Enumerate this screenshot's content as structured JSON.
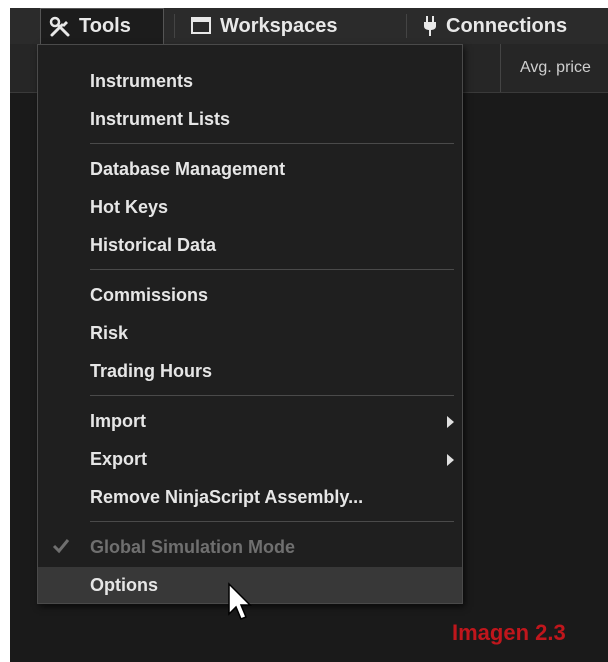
{
  "menubar": {
    "tools": "Tools",
    "workspaces": "Workspaces",
    "connections": "Connections"
  },
  "grid": {
    "avg_price_header": "Avg. price"
  },
  "dropdown": {
    "instruments": "Instruments",
    "instrument_lists": "Instrument Lists",
    "database_management": "Database Management",
    "hot_keys": "Hot Keys",
    "historical_data": "Historical Data",
    "commissions": "Commissions",
    "risk": "Risk",
    "trading_hours": "Trading Hours",
    "import": "Import",
    "export": "Export",
    "remove_ninjascript": "Remove NinjaScript Assembly...",
    "global_simulation_mode": "Global Simulation Mode",
    "options": "Options"
  },
  "watermark": "Imagen 2.3",
  "icons": {
    "tools": "wrench-screwdriver-icon",
    "workspaces": "window-icon",
    "connections": "plug-icon",
    "check": "check-icon",
    "submenu": "chevron-right-icon",
    "cursor": "mouse-pointer-icon"
  },
  "colors": {
    "background": "#1a1a1a",
    "menu_bg": "#1f1f1f",
    "text": "#e6e6e6",
    "disabled_text": "#6f6f6f",
    "hover_bg": "#383838",
    "watermark": "#c0161c"
  }
}
